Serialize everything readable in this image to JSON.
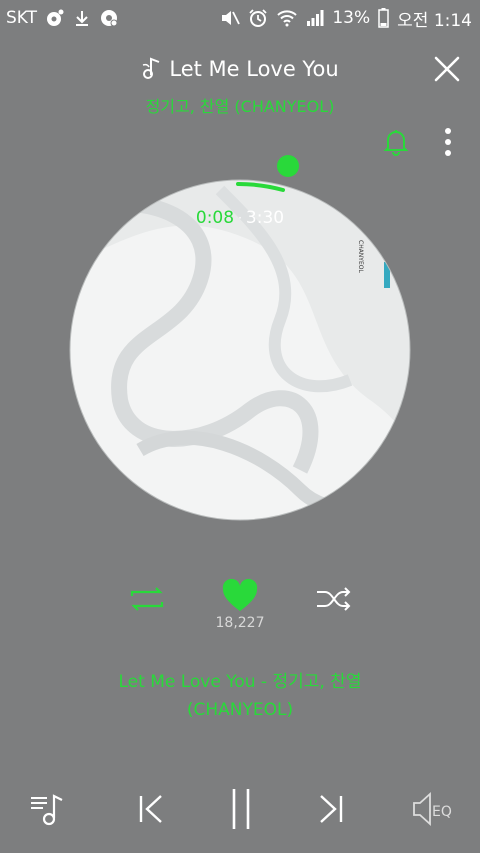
{
  "status_bar": {
    "carrier": "SKT",
    "battery": "13%",
    "time": "오전 1:14"
  },
  "player": {
    "title": "Let Me Love You",
    "artist": "정기고, 찬열 (CHANYEOL)",
    "current_time": "0:08",
    "separator": "·",
    "total_time": "3:30",
    "progress": 0.038,
    "album_text": "CHANYEOL",
    "like_count": "18,227",
    "lyric_line1": "Let Me Love You - 정기고, 찬열",
    "lyric_line2": "(CHANYEOL)",
    "eq_label": "EQ"
  },
  "colors": {
    "accent": "#29d93a",
    "background": "#7d7e7f"
  },
  "icons": {
    "close": "close-icon",
    "bell": "bell-icon",
    "more": "more-vertical-icon",
    "repeat": "repeat-icon",
    "heart": "heart-icon",
    "shuffle": "shuffle-icon",
    "playlist": "playlist-icon",
    "previous": "previous-icon",
    "pause": "pause-icon",
    "next": "next-icon",
    "eq": "eq-icon"
  }
}
